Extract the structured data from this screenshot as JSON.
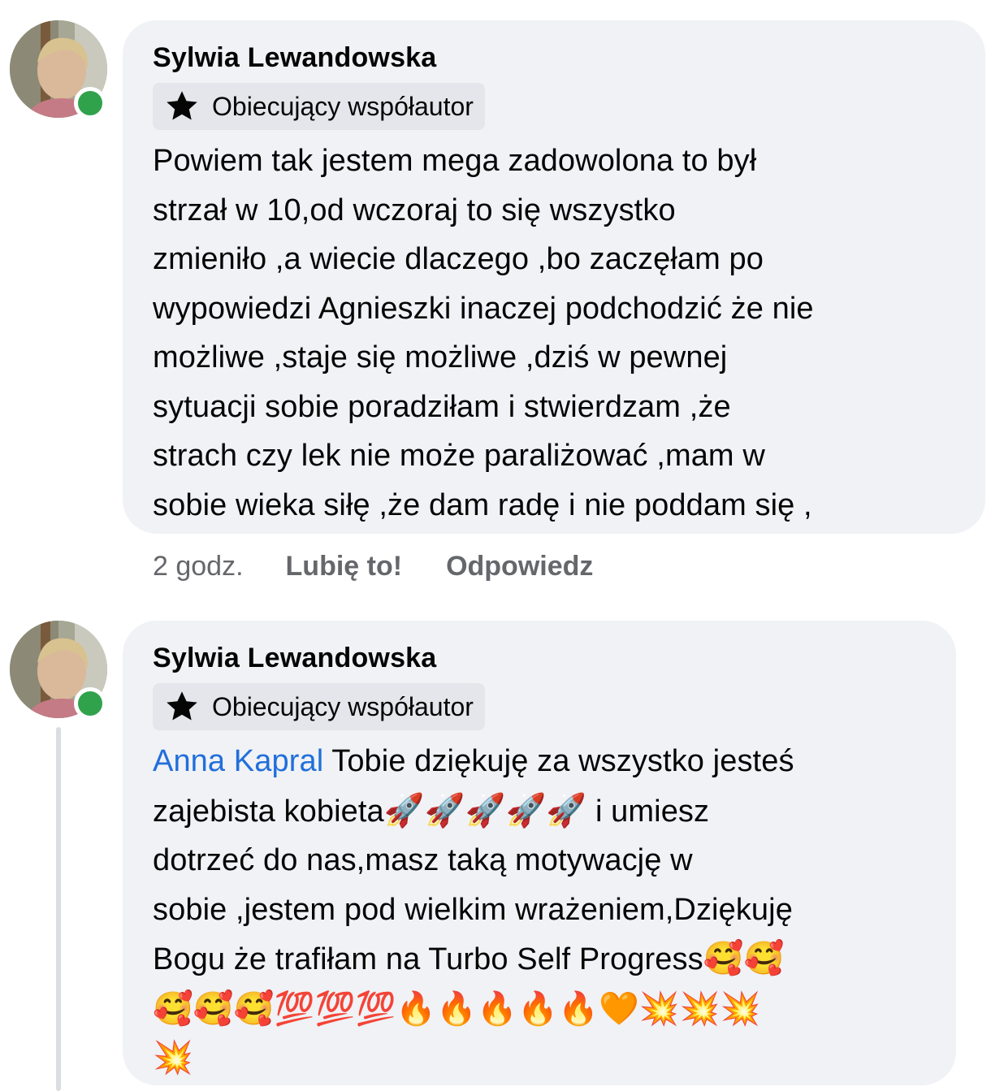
{
  "comments": [
    {
      "author": "Sylwia Lewandowska",
      "badge": "Obiecujący współautor",
      "mention": "",
      "lines": [
        "Powiem tak jestem mega zadowolona to był",
        "strzał w 10,od wczoraj to się wszystko",
        "zmieniło ,a wiecie dlaczego ,bo zaczęłam po",
        "wypowiedzi Agnieszki inaczej podchodzić że nie",
        "możliwe ,staje się możliwe ,dziś w pewnej",
        "sytuacji sobie poradziłam i stwierdzam ,że",
        "strach czy lek nie może paraliżować ,mam w",
        "sobie wieka siłę ,że dam radę i nie poddam się ,"
      ],
      "time": "2 godz.",
      "like_label": "Lubię to!",
      "reply_label": "Odpowiedz",
      "online": true
    },
    {
      "author": "Sylwia Lewandowska",
      "badge": "Obiecujący współautor",
      "mention": "Anna Kapral",
      "line1_rest": " Tobie dziękuję za wszystko jesteś",
      "line2": "zajebista kobieta",
      "line2_emoji": "🚀🚀🚀🚀🚀",
      "line2_rest": " i umiesz",
      "line3": "dotrzeć do nas,masz taką motywację w",
      "line4": "sobie ,jestem pod wielkim wrażeniem,Dziękuję",
      "line5": "Bogu że trafiłam na Turbo Self Progress",
      "line5_emoji": "🥰🥰",
      "line6_emoji": "🥰🥰🥰💯💯💯🔥🔥🔥🔥🔥🧡💥💥💥",
      "line7_emoji": "💥",
      "online": true
    }
  ],
  "icons": {
    "badge_icon": "star-icon",
    "status": "online-status-icon"
  },
  "colors": {
    "bubble": "#f0f2f5",
    "badge": "#e4e6eb",
    "mention": "#216fdb",
    "secondary_text": "#65676b",
    "online": "#31a24c"
  }
}
